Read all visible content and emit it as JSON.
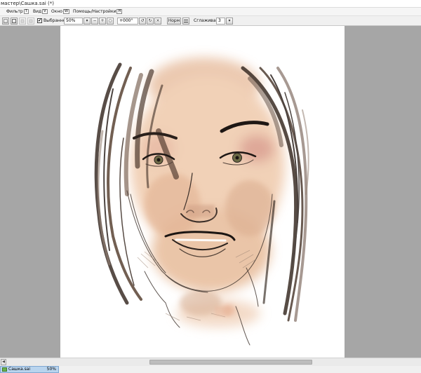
{
  "window": {
    "title": "мастер\\Сашка.sai (*)"
  },
  "menu": {
    "items": [
      {
        "label": "Фильтр",
        "accel": "T"
      },
      {
        "label": "Вид",
        "accel": "V"
      },
      {
        "label": "Окно",
        "accel": "W"
      },
      {
        "label": "Помощь/Настройки",
        "accel": "H"
      }
    ]
  },
  "toolbar": {
    "selection_label": "Выбранное",
    "selection_checked": "✔",
    "zoom_value": "50%",
    "rotation_value": "+000°",
    "blend_mode": "Норм",
    "stabilizer_label": "Сглаживание",
    "stabilizer_value": "3"
  },
  "canvas": {
    "background": "#a6a6a6",
    "paper": "#ffffff"
  },
  "scrollbar": {
    "left_arrow": "◀"
  },
  "statusbar": {
    "tab_name": "Сашка.sai",
    "tab_zoom": "50%"
  }
}
